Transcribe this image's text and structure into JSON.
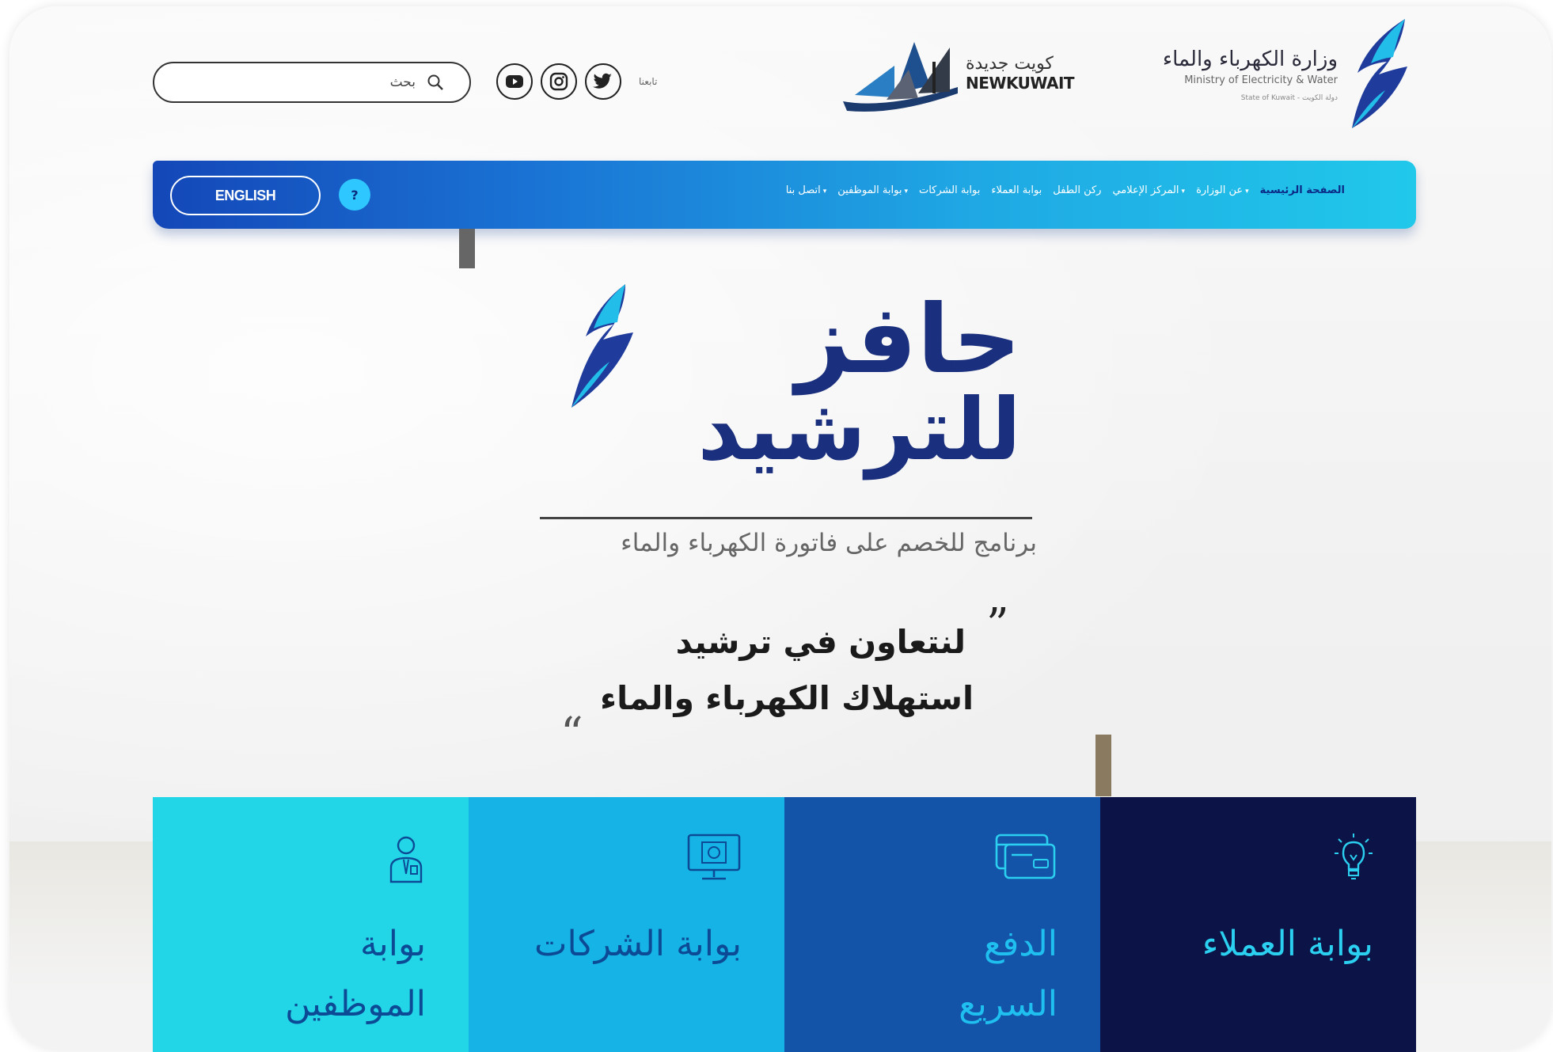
{
  "header": {
    "search_label": "بحث",
    "follow_label": "تابعنا",
    "newkuwait_arabic": "كويت جديدة",
    "newkuwait_latin": "NEWKUWAIT",
    "ministry_arabic": "وزارة الكهرباء والماء",
    "ministry_english": "Ministry of Electricity & Water",
    "ministry_state": "State of Kuwait - دولة الكويت"
  },
  "nav": {
    "english_label": "ENGLISH",
    "help_label": "?",
    "items": [
      {
        "label": "الصفحة الرئيسية",
        "active": true,
        "dropdown": false
      },
      {
        "label": "عن الوزارة",
        "active": false,
        "dropdown": true
      },
      {
        "label": "المركز الإعلامي",
        "active": false,
        "dropdown": true
      },
      {
        "label": "ركن الطفل",
        "active": false,
        "dropdown": false
      },
      {
        "label": "بوابة العملاء",
        "active": false,
        "dropdown": false
      },
      {
        "label": "بوابة الشركات",
        "active": false,
        "dropdown": false
      },
      {
        "label": "بوابة الموظفين",
        "active": false,
        "dropdown": true
      },
      {
        "label": "اتصل بنا",
        "active": false,
        "dropdown": true
      }
    ]
  },
  "hero": {
    "title_line1": "حافز",
    "title_line2": "للترشيد",
    "subtitle": "برنامج للخصم على فاتورة الكهرباء والماء",
    "slogan_line1": "لنتعاون في ترشيد",
    "slogan_line2": "استهلاك الكهرباء والماء",
    "quote_open": "”",
    "quote_close": "“"
  },
  "tiles": {
    "employees": {
      "line1": "بوابة",
      "line2": "الموظفين",
      "icon": "employee-icon"
    },
    "companies": {
      "label": "بوابة الشركات",
      "icon": "monitor-icon"
    },
    "payment": {
      "line1": "الدفع",
      "line2": "السريع",
      "icon": "credit-card-icon"
    },
    "customers": {
      "label": "بوابة العملاء",
      "icon": "lightbulb-icon"
    }
  },
  "colors": {
    "nav_start": "#1447b8",
    "nav_end": "#21c8ea",
    "title_navy": "#1a2f7d",
    "tile_1": "#22d6e8",
    "tile_2": "#16b4e6",
    "tile_3": "#1354a8",
    "tile_4": "#0b1347"
  }
}
